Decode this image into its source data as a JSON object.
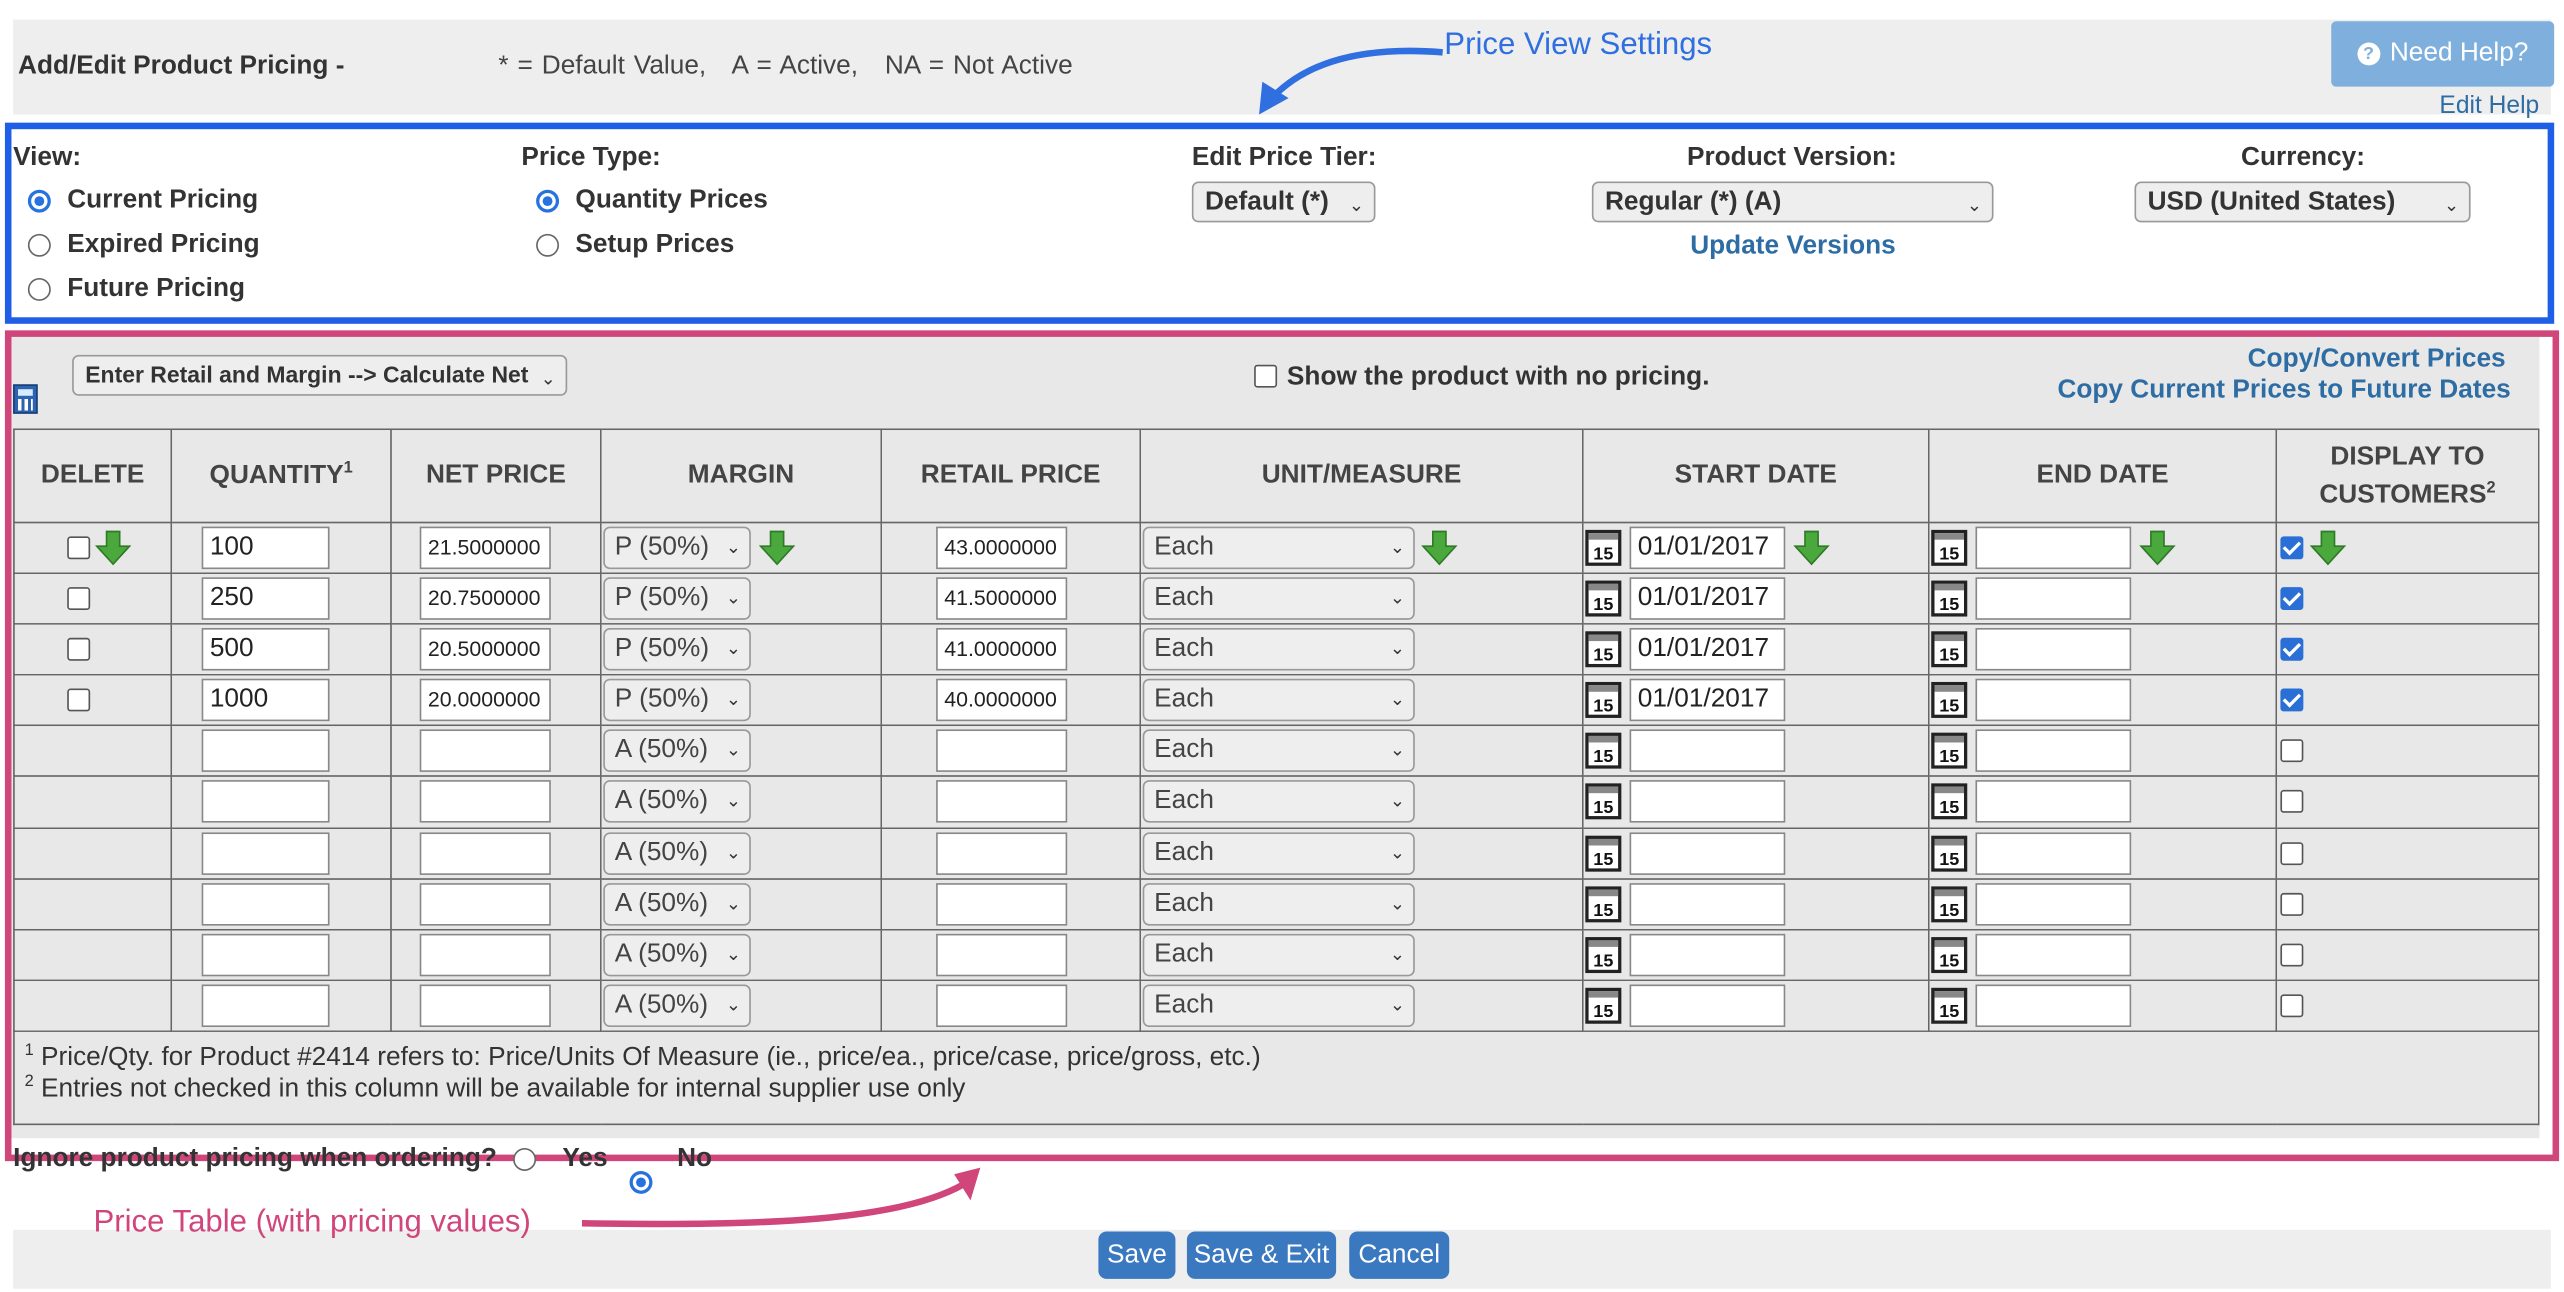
{
  "header": {
    "title": "Add/Edit Product Pricing -",
    "legend": "* = Default Value,   A = Active,   NA = Not Active",
    "help_button": "Need Help?",
    "edit_help": "Edit Help"
  },
  "annotations": {
    "price_view_settings": "Price View Settings",
    "price_table": "Price Table (with pricing values)"
  },
  "settings": {
    "view_label": "View:",
    "view_options": [
      "Current Pricing",
      "Expired Pricing",
      "Future Pricing"
    ],
    "view_selected": "Current Pricing",
    "price_type_label": "Price Type:",
    "price_type_options": [
      "Quantity Prices",
      "Setup Prices"
    ],
    "price_type_selected": "Quantity Prices",
    "tier_label": "Edit Price Tier:",
    "tier_value": "Default (*)",
    "version_label": "Product Version:",
    "version_value": "Regular (*) (A)",
    "update_versions": "Update Versions",
    "currency_label": "Currency:",
    "currency_value": "USD (United States)"
  },
  "table_tools": {
    "mode_select": "Enter Retail and Margin --> Calculate Net",
    "no_pricing_label": "Show the product with no pricing.",
    "copy_convert": "Copy/Convert Prices",
    "copy_future": "Copy Current Prices to Future Dates"
  },
  "columns": {
    "delete": "DELETE",
    "quantity": "QUANTITY",
    "quantity_sup": "1",
    "net_price": "NET PRICE",
    "margin": "MARGIN",
    "retail_price": "RETAIL PRICE",
    "unit": "UNIT/MEASURE",
    "start_date": "START DATE",
    "end_date": "END DATE",
    "display_line1": "DISPLAY TO",
    "display_line2": "CUSTOMERS",
    "display_sup": "2"
  },
  "rows": [
    {
      "qty": "100",
      "net": "21.5000000",
      "margin": "P (50%)",
      "retail": "43.0000000",
      "unit": "Each",
      "start": "01/01/2017",
      "end": "",
      "display": true,
      "deletable": true
    },
    {
      "qty": "250",
      "net": "20.7500000",
      "margin": "P (50%)",
      "retail": "41.5000000",
      "unit": "Each",
      "start": "01/01/2017",
      "end": "",
      "display": true,
      "deletable": true
    },
    {
      "qty": "500",
      "net": "20.5000000",
      "margin": "P (50%)",
      "retail": "41.0000000",
      "unit": "Each",
      "start": "01/01/2017",
      "end": "",
      "display": true,
      "deletable": true
    },
    {
      "qty": "1000",
      "net": "20.0000000",
      "margin": "P (50%)",
      "retail": "40.0000000",
      "unit": "Each",
      "start": "01/01/2017",
      "end": "",
      "display": true,
      "deletable": true
    },
    {
      "qty": "",
      "net": "",
      "margin": "A (50%)",
      "retail": "",
      "unit": "Each",
      "start": "",
      "end": "",
      "display": false,
      "deletable": false
    },
    {
      "qty": "",
      "net": "",
      "margin": "A (50%)",
      "retail": "",
      "unit": "Each",
      "start": "",
      "end": "",
      "display": false,
      "deletable": false
    },
    {
      "qty": "",
      "net": "",
      "margin": "A (50%)",
      "retail": "",
      "unit": "Each",
      "start": "",
      "end": "",
      "display": false,
      "deletable": false
    },
    {
      "qty": "",
      "net": "",
      "margin": "A (50%)",
      "retail": "",
      "unit": "Each",
      "start": "",
      "end": "",
      "display": false,
      "deletable": false
    },
    {
      "qty": "",
      "net": "",
      "margin": "A (50%)",
      "retail": "",
      "unit": "Each",
      "start": "",
      "end": "",
      "display": false,
      "deletable": false
    },
    {
      "qty": "",
      "net": "",
      "margin": "A (50%)",
      "retail": "",
      "unit": "Each",
      "start": "",
      "end": "",
      "display": false,
      "deletable": false
    }
  ],
  "calendar_icon_text": "15",
  "footnotes": {
    "note1_mark": "1",
    "note1": "Price/Qty. for Product #2414 refers to: Price/Units Of Measure (ie., price/ea., price/case, price/gross, etc.)",
    "note2_mark": "2",
    "note2": "Entries not checked in this column will be available for internal supplier use only"
  },
  "ignore_pricing": {
    "label": "Ignore product pricing when ordering?",
    "yes": "Yes",
    "no": "No",
    "selected": "No"
  },
  "buttons": {
    "save": "Save",
    "save_exit": "Save & Exit",
    "cancel": "Cancel"
  },
  "colors": {
    "annotation_blue": "#1f5fe8",
    "annotation_pink": "#d0457a",
    "link": "#2e6da4",
    "button": "#3a78c0",
    "help_button": "#7fb0dd"
  }
}
